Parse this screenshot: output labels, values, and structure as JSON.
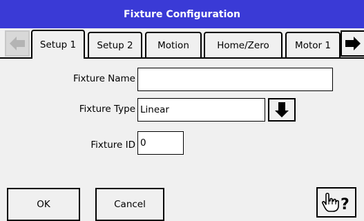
{
  "window": {
    "title": "Fixture Configuration"
  },
  "tabs": [
    "Setup 1",
    "Setup 2",
    "Motion",
    "Home/Zero",
    "Motor 1"
  ],
  "active_tab": "Setup 1",
  "form": {
    "fixture_name": {
      "label": "Fixture Name",
      "value": ""
    },
    "fixture_type": {
      "label": "Fixture Type",
      "value": "Linear"
    },
    "fixture_id": {
      "label": "Fixture ID",
      "value": "0"
    }
  },
  "buttons": {
    "ok": "OK",
    "cancel": "Cancel"
  },
  "icons": {
    "tab_scroll_left": "arrow-left-icon",
    "tab_scroll_right": "arrow-right-icon",
    "dropdown": "arrow-down-icon",
    "help": "hand-pointer-question-icon"
  },
  "colors": {
    "titlebar": "#3a3ad6",
    "background": "#f0f0f0"
  }
}
